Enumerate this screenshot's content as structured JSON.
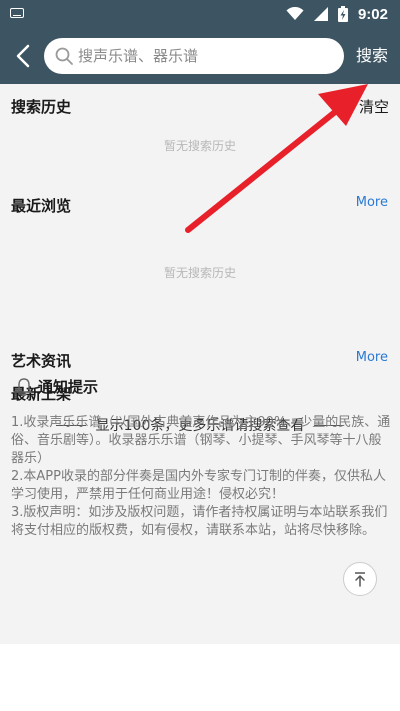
{
  "status_bar": {
    "time": "9:02",
    "icons": [
      "keyboard-icon",
      "wifi-icon",
      "signal-icon",
      "battery-charging-icon"
    ]
  },
  "header": {
    "back_icon": "back-arrow-icon",
    "search_icon": "search-icon",
    "search_placeholder": "搜声乐谱、器乐谱",
    "search_value": "",
    "search_button": "搜索"
  },
  "search_history": {
    "title": "搜索历史",
    "clear_label": "清空",
    "empty_text": "暂无搜索历史"
  },
  "recent": {
    "title": "最近浏览",
    "more_label": "More",
    "empty_text": "暂无搜索历史"
  },
  "art_news": {
    "title": "艺术资讯",
    "more_label": "More"
  },
  "new_arrivals": {
    "title": "最新上架",
    "note": "显示100条，更多乐谱请搜索查看"
  },
  "notice": {
    "icon": "bell-icon",
    "title": "通知提示",
    "paragraphs": [
      "1.收录声乐乐谱（以国外古典美声作品为主90%、少量的民族、通俗、音乐剧等）。收录器乐乐谱（钢琴、小提琴、手风琴等十八般器乐）",
      "2.本APP收录的部分伴奏是国内外专家专门订制的伴奏，仅供私人学习使用，严禁用于任何商业用途！侵权必究！",
      "3.版权声明：如涉及版权问题，请作者持权属证明与本站联系我们将支付相应的版权费，如有侵权，请联系本站，站将尽快移除。"
    ]
  },
  "colors": {
    "header_bg": "#3d5563",
    "content_bg": "#f3f3f3",
    "link": "#2a7ad4",
    "annotation_arrow": "#e8202a"
  }
}
